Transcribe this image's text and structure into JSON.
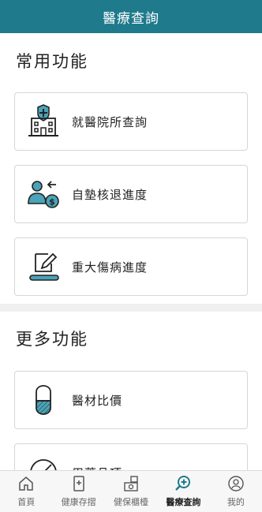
{
  "header": {
    "title": "醫療查詢"
  },
  "sections": [
    {
      "title": "常用功能"
    },
    {
      "title": "更多功能"
    }
  ],
  "cards": [
    {
      "label": "就醫院所查詢",
      "icon": "hospital-icon"
    },
    {
      "label": "自墊核退進度",
      "icon": "reimbursement-icon"
    },
    {
      "label": "重大傷病進度",
      "icon": "edit-document-icon"
    },
    {
      "label": "醫材比價",
      "icon": "capsule-icon"
    },
    {
      "label": "用藥品項",
      "icon": "medicine-icon"
    }
  ],
  "tabs": [
    {
      "label": "首頁",
      "icon": "home-icon"
    },
    {
      "label": "健康存摺",
      "icon": "health-passbook-icon"
    },
    {
      "label": "健保櫃檯",
      "icon": "counter-icon"
    },
    {
      "label": "醫療查詢",
      "icon": "medical-search-icon",
      "active": true
    },
    {
      "label": "我的",
      "icon": "profile-icon"
    }
  ],
  "colors": {
    "brand": "#1f7a8c",
    "accent_light": "#4aa3b8",
    "icon_dark": "#222222"
  }
}
